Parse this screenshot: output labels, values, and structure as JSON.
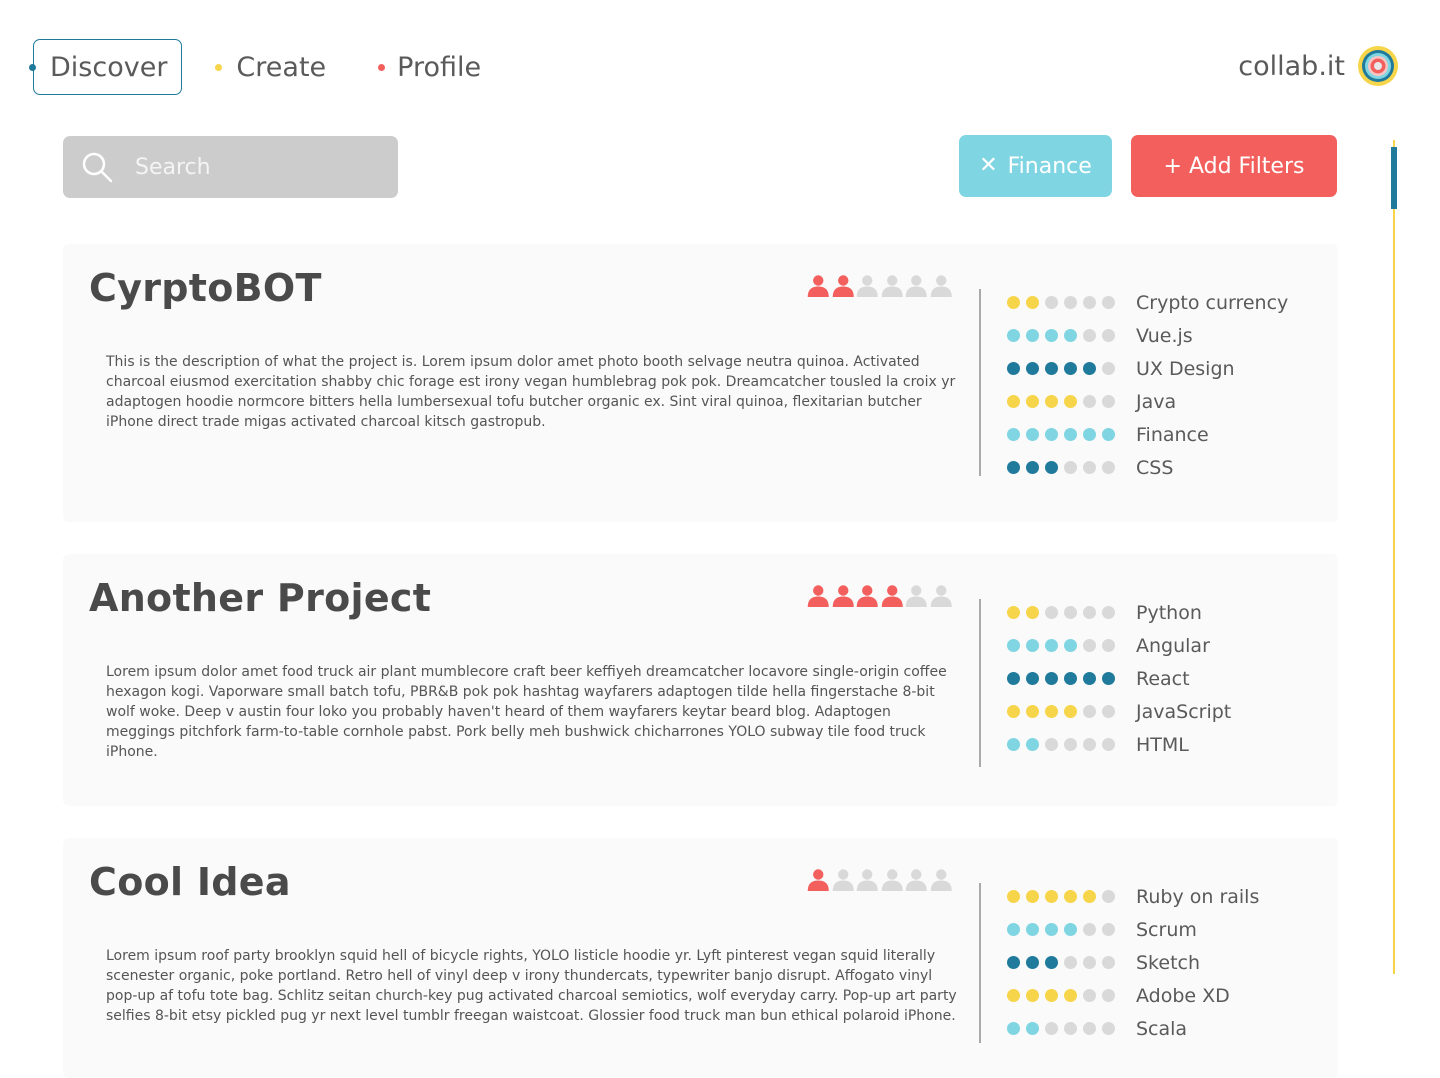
{
  "nav": {
    "items": [
      {
        "label": "Discover",
        "dot_color": "#1f7a9b",
        "active": true
      },
      {
        "label": "Create",
        "dot_color": "#f7d54a",
        "active": false
      },
      {
        "label": "Profile",
        "dot_color": "#f25f5c",
        "active": false
      }
    ],
    "brand": "collab.it"
  },
  "search": {
    "placeholder": "Search"
  },
  "filters": {
    "active_chip": "Finance",
    "add_label": "+ Add Filters"
  },
  "colors": {
    "yellow": "#f7d54a",
    "light_blue": "#80d5e2",
    "dark_blue": "#1f7a9b",
    "red": "#f25f5c",
    "inactive": "#d9d9d9"
  },
  "projects": [
    {
      "title": "CyrptoBOT",
      "description": "This is the description of what the project is. Lorem ipsum dolor amet photo booth selvage neutra quinoa. Activated charcoal eiusmod exercitation shabby chic forage est irony vegan humblebrag pok pok. Dreamcatcher tousled la croix yr adaptogen hoodie normcore bitters hella lumbersexual tofu butcher organic ex. Sint viral quinoa, flexitarian butcher iPhone direct trade migas activated charcoal kitsch gastropub.",
      "members_filled": 2,
      "members_total": 6,
      "skills": [
        {
          "name": "Crypto currency",
          "level": 2,
          "color": "yellow"
        },
        {
          "name": "Vue.js",
          "level": 4,
          "color": "light_blue"
        },
        {
          "name": "UX Design",
          "level": 5,
          "color": "dark_blue"
        },
        {
          "name": "Java",
          "level": 4,
          "color": "yellow"
        },
        {
          "name": "Finance",
          "level": 6,
          "color": "light_blue"
        },
        {
          "name": "CSS",
          "level": 3,
          "color": "dark_blue"
        }
      ]
    },
    {
      "title": "Another Project",
      "description": "Lorem ipsum dolor amet food truck air plant mumblecore craft beer keffiyeh dreamcatcher locavore single-origin coffee hexagon kogi. Vaporware small batch tofu, PBR&B pok pok hashtag wayfarers adaptogen tilde hella fingerstache 8-bit wolf woke. Deep v austin four loko you probably haven't heard of them wayfarers keytar beard blog. Adaptogen meggings pitchfork farm-to-table cornhole pabst. Pork belly meh bushwick chicharrones YOLO subway tile food truck iPhone.",
      "members_filled": 4,
      "members_total": 6,
      "skills": [
        {
          "name": "Python",
          "level": 2,
          "color": "yellow"
        },
        {
          "name": "Angular",
          "level": 4,
          "color": "light_blue"
        },
        {
          "name": "React",
          "level": 6,
          "color": "dark_blue"
        },
        {
          "name": "JavaScript",
          "level": 4,
          "color": "yellow"
        },
        {
          "name": "HTML",
          "level": 2,
          "color": "light_blue"
        }
      ]
    },
    {
      "title": "Cool Idea",
      "description": "Lorem ipsum roof party brooklyn squid hell of bicycle rights, YOLO listicle hoodie yr. Lyft pinterest vegan squid literally scenester organic, poke portland. Retro hell of vinyl deep v irony thundercats, typewriter banjo disrupt. Affogato vinyl pop-up af tofu tote bag. Schlitz seitan church-key pug activated charcoal semiotics, wolf everyday carry. Pop-up art party selfies 8-bit etsy pickled pug yr next level tumblr freegan waistcoat. Glossier food truck man bun ethical polaroid iPhone.",
      "members_filled": 1,
      "members_total": 6,
      "skills": [
        {
          "name": "Ruby on rails",
          "level": 5,
          "color": "yellow"
        },
        {
          "name": "Scrum",
          "level": 4,
          "color": "light_blue"
        },
        {
          "name": "Sketch",
          "level": 3,
          "color": "dark_blue"
        },
        {
          "name": "Adobe XD",
          "level": 4,
          "color": "yellow"
        },
        {
          "name": "Scala",
          "level": 2,
          "color": "light_blue"
        }
      ]
    }
  ]
}
